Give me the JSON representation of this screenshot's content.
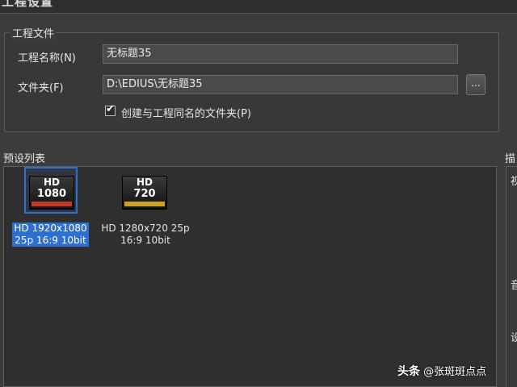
{
  "window": {
    "title": "工程设置"
  },
  "project_group": {
    "legend": "工程文件",
    "name_label": "工程名称(N)",
    "name_value": "无标题35",
    "folder_label": "文件夹(F)",
    "folder_value": "D:\\EDIUS\\无标题35",
    "browse_label": "...",
    "create_folder_checkbox": {
      "checked": true,
      "label": "创建与工程同名的文件夹(P)"
    }
  },
  "preset_list": {
    "label": "预设列表",
    "items": [
      {
        "icon_top": "HD",
        "icon_bottom": "1080",
        "icon_bar_color": "#c0392b",
        "caption_line1": "HD 1920x1080",
        "caption_line2": "25p 16:9 10bit",
        "selected": true
      },
      {
        "icon_top": "HD",
        "icon_bottom": "720",
        "icon_bar_color": "#c9a227",
        "caption_line1": "HD 1280x720 25p",
        "caption_line2": "16:9 10bit",
        "selected": false
      }
    ]
  },
  "right_panel": {
    "label_partial": "描",
    "chars": [
      "视",
      "音",
      "设"
    ]
  },
  "watermark": {
    "brand": "头条",
    "handle": "@张斑斑点点"
  },
  "colors": {
    "selection": "#2f6fcf",
    "background": "#3c3c3c",
    "panel": "#2f2f2f"
  }
}
